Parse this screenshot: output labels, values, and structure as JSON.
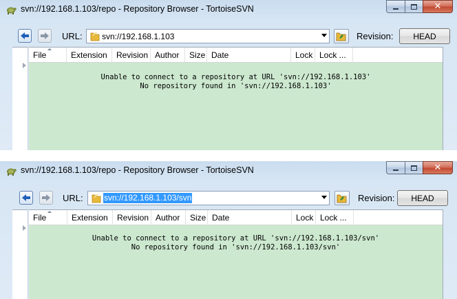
{
  "windows": [
    {
      "title": "svn://192.168.1.103/repo - Repository Browser - TortoiseSVN",
      "url_label": "URL:",
      "url_value": "svn://192.168.1.103",
      "url_selected": false,
      "revision_label": "Revision:",
      "revision_button": "HEAD",
      "columns": [
        "File",
        "Extension",
        "Revision",
        "Author",
        "Size",
        "Date",
        "Lock",
        "Lock ..."
      ],
      "message_line1": "Unable to connect to a repository at URL 'svn://192.168.1.103'",
      "message_line2": "No repository found in 'svn://192.168.1.103'"
    },
    {
      "title": "svn://192.168.1.103/repo - Repository Browser - TortoiseSVN",
      "url_label": "URL:",
      "url_value": "svn://192.168.1.103/svn",
      "url_selected": true,
      "revision_label": "Revision:",
      "revision_button": "HEAD",
      "columns": [
        "File",
        "Extension",
        "Revision",
        "Author",
        "Size",
        "Date",
        "Lock",
        "Lock ..."
      ],
      "message_line1": "Unable to connect to a repository at URL 'svn://192.168.1.103/svn'",
      "message_line2": "No repository found in 'svn://192.168.1.103/svn'"
    }
  ],
  "icons": {
    "app": "tortoise-icon",
    "back": "back-arrow-icon",
    "forward": "forward-arrow-icon",
    "folder": "folder-icon",
    "browse": "browse-folder-icon",
    "minimize": "minimize-icon",
    "maximize": "maximize-icon",
    "close": "close-icon"
  },
  "colors": {
    "list_background": "#cce8cf",
    "selection": "#3399ff",
    "close_button": "#c24a33"
  }
}
